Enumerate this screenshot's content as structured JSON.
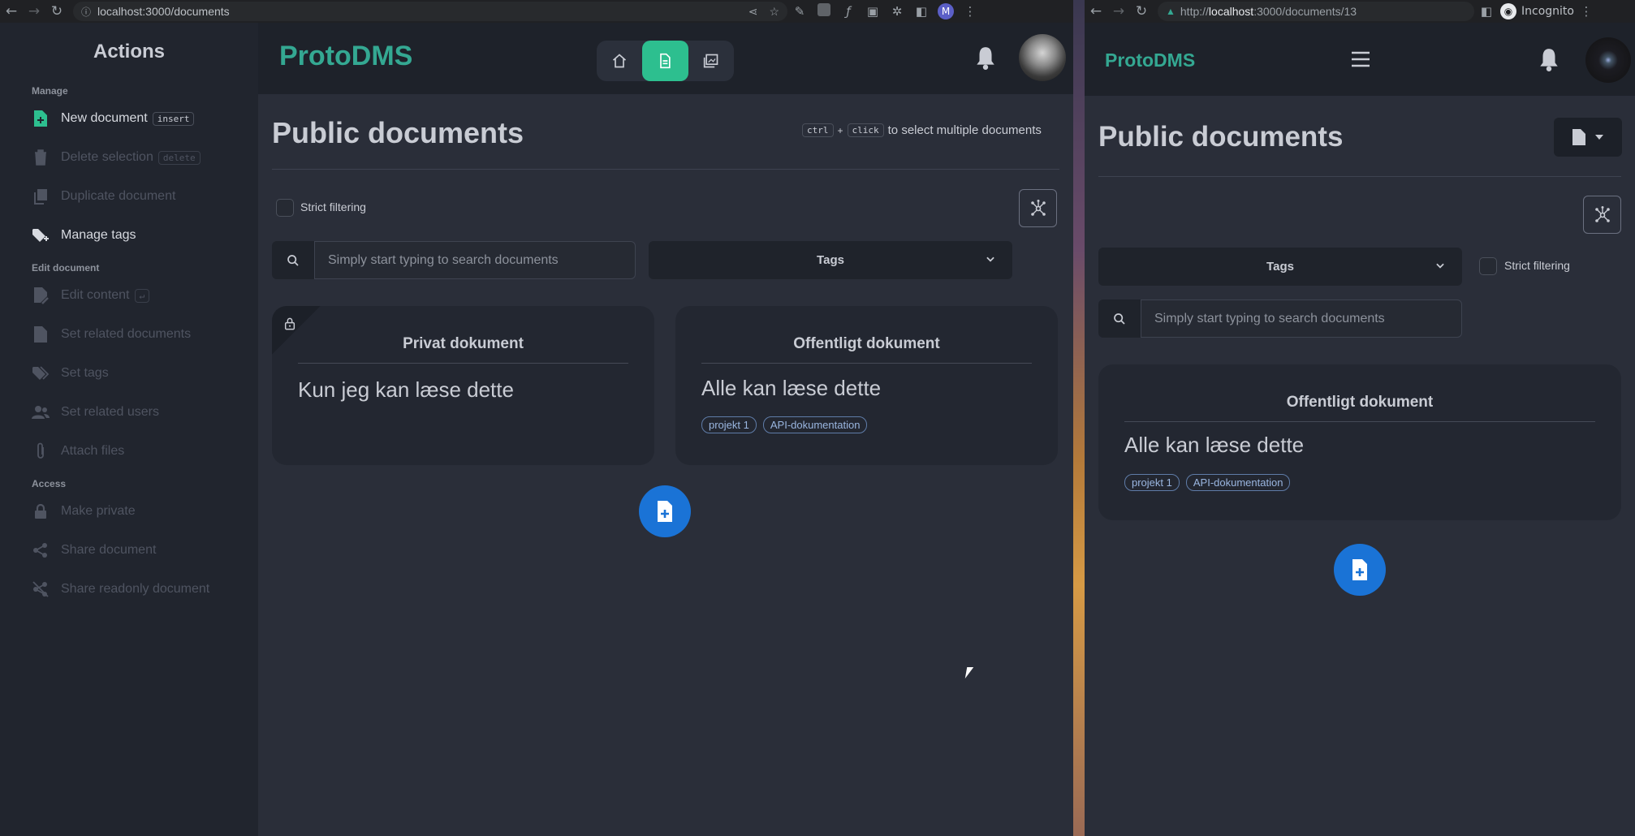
{
  "left_window": {
    "chrome": {
      "url": "localhost:3000/documents",
      "profile_initial": "M"
    },
    "sidebar": {
      "title": "Actions",
      "sections": [
        {
          "label": "Manage",
          "items": [
            {
              "label": "New document",
              "kbd": "insert",
              "enabled": true,
              "icon": "file-plus-icon"
            },
            {
              "label": "Delete selection",
              "kbd": "delete",
              "enabled": false,
              "icon": "trash-icon"
            },
            {
              "label": "Duplicate document",
              "kbd": "",
              "enabled": false,
              "icon": "copy-icon"
            },
            {
              "label": "Manage tags",
              "kbd": "",
              "enabled": true,
              "icon": "tag-plus-icon"
            }
          ]
        },
        {
          "label": "Edit document",
          "items": [
            {
              "label": "Edit content",
              "kbd": "↵",
              "enabled": false,
              "icon": "file-edit-icon"
            },
            {
              "label": "Set related documents",
              "kbd": "",
              "enabled": false,
              "icon": "file-link-icon"
            },
            {
              "label": "Set tags",
              "kbd": "",
              "enabled": false,
              "icon": "tags-icon"
            },
            {
              "label": "Set related users",
              "kbd": "",
              "enabled": false,
              "icon": "users-icon"
            },
            {
              "label": "Attach files",
              "kbd": "",
              "enabled": false,
              "icon": "paperclip-icon"
            }
          ]
        },
        {
          "label": "Access",
          "items": [
            {
              "label": "Make private",
              "kbd": "",
              "enabled": false,
              "icon": "lock-icon"
            },
            {
              "label": "Share document",
              "kbd": "",
              "enabled": false,
              "icon": "share-icon"
            },
            {
              "label": "Share readonly document",
              "kbd": "",
              "enabled": false,
              "icon": "share-off-icon"
            }
          ]
        }
      ]
    },
    "header": {
      "logo": "ProtoDMS"
    },
    "page_title": "Public documents",
    "hint": {
      "key1": "ctrl",
      "plus": "+",
      "key2": "click",
      "text": "to select multiple documents"
    },
    "strict_filtering_label": "Strict filtering",
    "search_placeholder": "Simply start typing to search documents",
    "tags_label": "Tags",
    "cards": [
      {
        "title": "Privat dokument",
        "body": "Kun jeg kan læse dette",
        "tags": [],
        "private": true
      },
      {
        "title": "Offentligt dokument",
        "body": "Alle kan læse dette",
        "tags": [
          "projekt 1",
          "API-dokumentation"
        ],
        "private": false
      }
    ]
  },
  "right_window": {
    "chrome": {
      "url_prefix": "http://",
      "url_host": "localhost",
      "url_rest": ":3000/documents/13",
      "incognito": "Incognito"
    },
    "header": {
      "logo": "ProtoDMS"
    },
    "page_title": "Public documents",
    "tags_label": "Tags",
    "strict_filtering_label": "Strict filtering",
    "search_placeholder": "Simply start typing to search documents",
    "cards": [
      {
        "title": "Offentligt dokument",
        "body": "Alle kan læse dette",
        "tags": [
          "projekt 1",
          "API-dokumentation"
        ]
      }
    ]
  },
  "colors": {
    "accent": "#2dbf8f",
    "logo": "#34a892",
    "fab": "#1a73d6",
    "bg": "#2a2e39",
    "sidebar": "#21252e"
  }
}
